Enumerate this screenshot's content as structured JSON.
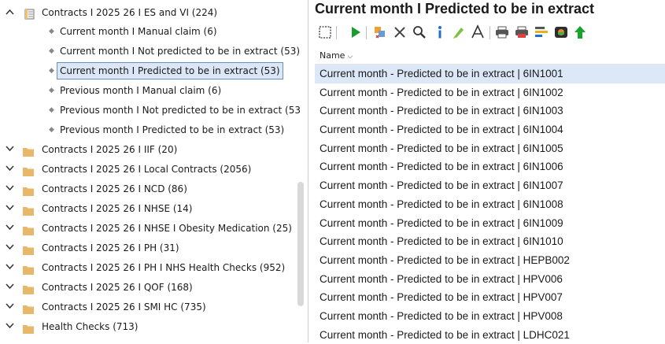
{
  "tree": {
    "expanded_folder": {
      "label": "Contracts I 2025 26 I ES and VI (224)"
    },
    "children": [
      {
        "label": "Current month I Manual claim (6)"
      },
      {
        "label": "Current month I Not predicted to be in extract (53)"
      },
      {
        "label": "Current month I Predicted to be in extract (53)",
        "selected": true
      },
      {
        "label": "Previous month I Manual claim (6)"
      },
      {
        "label": "Previous month I Not predicted to be in extract (53"
      },
      {
        "label": "Previous month I Predicted to be in extract (53)"
      }
    ],
    "folders": [
      {
        "label": "Contracts I 2025 26 I IIF (20)"
      },
      {
        "label": "Contracts I 2025 26 I Local Contracts (2056)"
      },
      {
        "label": "Contracts I 2025 26 I NCD (86)"
      },
      {
        "label": "Contracts I 2025 26 I NHSE (14)"
      },
      {
        "label": "Contracts I 2025 26 I NHSE I Obesity Medication (25)"
      },
      {
        "label": "Contracts I 2025 26 I PH (31)"
      },
      {
        "label": "Contracts I 2025 26 I PH I NHS Health Checks (952)"
      },
      {
        "label": "Contracts I 2025 26 I QOF (168)"
      },
      {
        "label": "Contracts I 2025 26 I SMI HC (735)"
      },
      {
        "label": "Health Checks (713)"
      }
    ]
  },
  "pane": {
    "title": "Current month I Predicted to be in extract",
    "column_header": "Name",
    "rows": [
      "Current month - Predicted to be in extract | 6IN1001",
      "Current month - Predicted to be in extract | 6IN1002",
      "Current month - Predicted to be in extract | 6IN1003",
      "Current month - Predicted to be in extract | 6IN1004",
      "Current month - Predicted to be in extract | 6IN1005",
      "Current month - Predicted to be in extract | 6IN1006",
      "Current month - Predicted to be in extract | 6IN1007",
      "Current month - Predicted to be in extract | 6IN1008",
      "Current month - Predicted to be in extract | 6IN1009",
      "Current month - Predicted to be in extract | 6IN1010",
      "Current month - Predicted to be in extract | HEPB002",
      "Current month - Predicted to be in extract | HPV006",
      "Current month - Predicted to be in extract | HPV007",
      "Current month - Predicted to be in extract | HPV008",
      "Current month - Predicted to be in extract | LDHC021"
    ]
  },
  "toolbar_icons": [
    "select-box-icon",
    "run-icon",
    "merge-icon",
    "delete-icon",
    "search-icon",
    "info-icon",
    "highlight-icon",
    "font-icon",
    "print-icon",
    "print-red-icon",
    "format-icon",
    "record-icon",
    "up-arrow-icon"
  ],
  "colors": {
    "selected_bg": "#dce8f7",
    "folder": "#e8b86a",
    "run": "#1a9c2a"
  }
}
